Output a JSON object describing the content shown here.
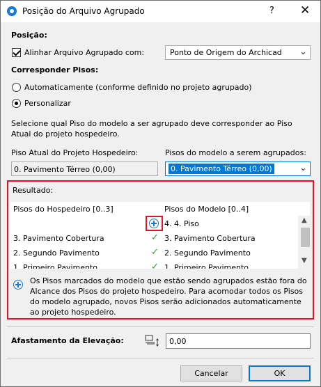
{
  "window": {
    "title": "Posição do Arquivo Agrupado",
    "help": "?",
    "close": "✕"
  },
  "position": {
    "heading": "Posição:",
    "align_label": "Alinhar Arquivo Agrupado com:",
    "align_checked": true,
    "align_value": "Ponto de Origem do Archicad"
  },
  "floors": {
    "heading": "Corresponder Pisos:",
    "option_auto": "Automaticamente (conforme definido no projeto agrupado)",
    "option_custom": "Personalizar",
    "selected_option": "Personalizar",
    "instruction": "Selecione qual Piso do modelo a ser agrupado deve corresponder ao Piso Atual do projeto hospedeiro.",
    "host_label": "Piso Atual do Projeto Hospedeiro:",
    "host_value": "0. Pavimento Térreo (0,00)",
    "model_label": "Pisos do modelo a serem agrupados:",
    "model_value": "0. Pavimento Térreo (0,00)"
  },
  "result": {
    "heading": "Resultado:",
    "col_host": "Pisos do Hospedeiro [0..3]",
    "col_model": "Pisos do Modelo [0..4]",
    "rows": [
      {
        "host": "",
        "status": "add",
        "model": "4. 4. Piso"
      },
      {
        "host": "3. Pavimento Cobertura",
        "status": "✓",
        "model": "3. Pavimento Cobertura"
      },
      {
        "host": "2. Segundo Pavimento",
        "status": "✓",
        "model": "2. Segundo Pavimento"
      },
      {
        "host": "1. Primeiro Pavimento",
        "status": "✓",
        "model": "1. Primeiro Pavimento"
      }
    ],
    "info": "Os Pisos marcados do modelo que estão sendo agrupados estão fora do Alcance dos Pisos do projeto hospedeiro. Para acomodar todos os Pisos do modelo agrupado, novos Pisos serão adicionados automaticamente ao projeto hospedeiro."
  },
  "elevation": {
    "label": "Afastamento da Elevação:",
    "value": "0,00"
  },
  "buttons": {
    "cancel": "Cancelar",
    "ok": "OK"
  },
  "colors": {
    "highlight_border": "#e81123",
    "accent": "#0078d7",
    "check": "#2e9d3a"
  }
}
